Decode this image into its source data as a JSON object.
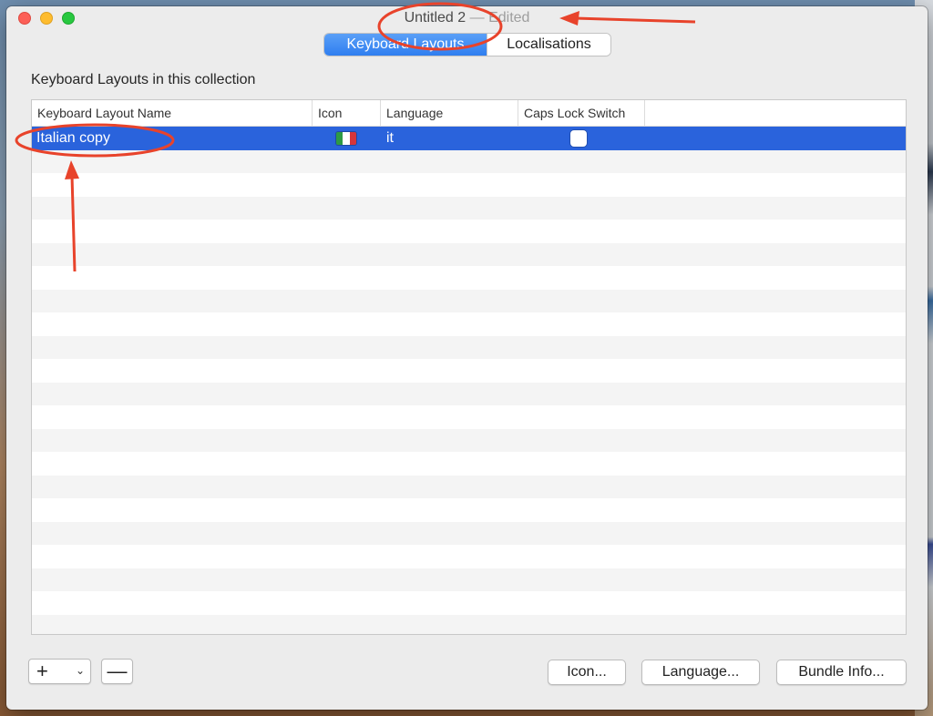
{
  "window": {
    "title": "Untitled 2",
    "title_separator": "—",
    "title_status": "Edited"
  },
  "tabs": [
    {
      "label": "Keyboard Layouts",
      "selected": true
    },
    {
      "label": "Localisations",
      "selected": false
    }
  ],
  "collection": {
    "section_label": "Keyboard Layouts in this collection",
    "columns": [
      "Keyboard Layout Name",
      "Icon",
      "Language",
      "Caps Lock Switch"
    ],
    "rows": [
      {
        "name": "Italian copy",
        "icon": "italian-flag-icon",
        "language": "it",
        "caps_lock_switch": false,
        "selected": true
      }
    ]
  },
  "toolbar": {
    "add_symbol": "+",
    "remove_symbol": "—",
    "icon_button": "Icon...",
    "language_button": "Language...",
    "bundle_info_button": "Bundle Info..."
  },
  "colors": {
    "selection": "#2a63dc",
    "segment_active": "#3a86f3",
    "annotation": "#e8432b",
    "flag_green": "#2e9a45",
    "flag_white": "#ffffff",
    "flag_red": "#d6353b"
  }
}
